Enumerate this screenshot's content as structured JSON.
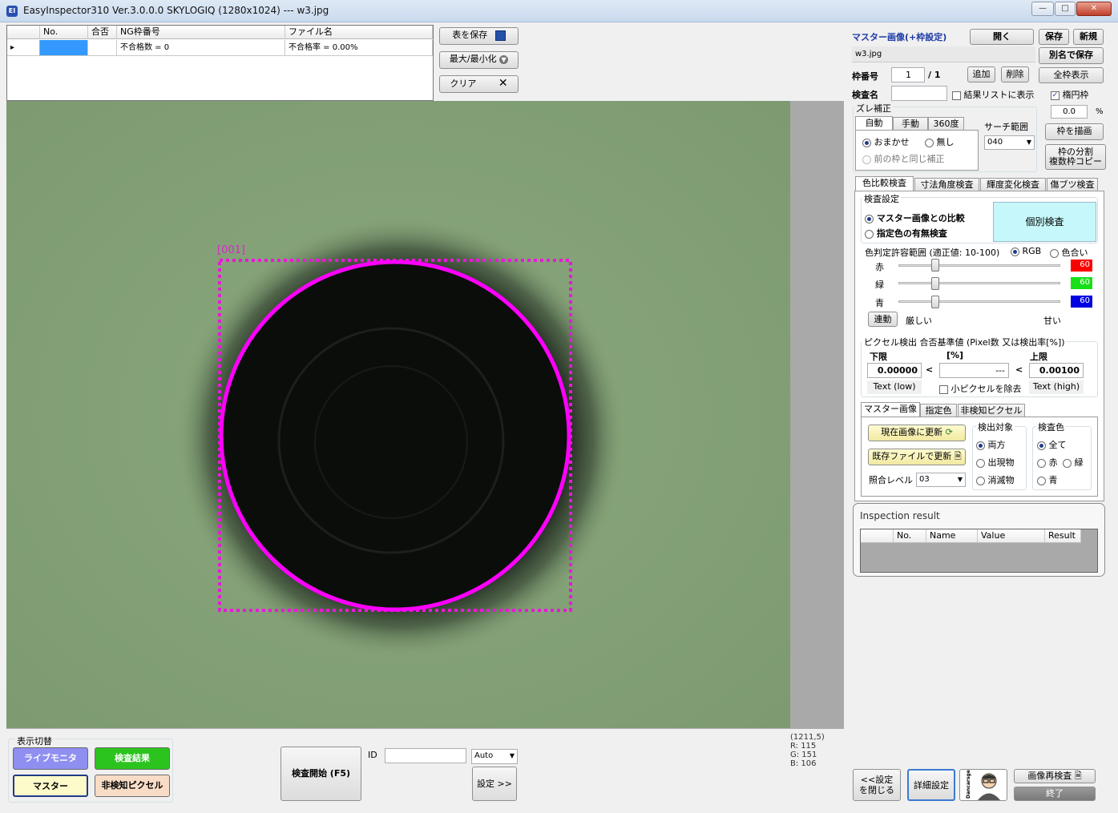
{
  "window": {
    "title": "EasyInspector310 Ver.3.0.0.0 SKYLOGIQ (1280x1024) --- w3.jpg",
    "min": "—",
    "max": "□",
    "close": "✕"
  },
  "grid": {
    "headers": [
      "No.",
      "合否",
      "NG枠番号",
      "ファイル名"
    ],
    "row": {
      "no": "",
      "pass": "",
      "ng": "不合格数 = 0",
      "file": "不合格率 = 0.00%"
    }
  },
  "buttons": {
    "save_table": "表を保存",
    "maxmin": "最大/最小化",
    "clear": "クリア"
  },
  "image": {
    "frame_label": "[001]"
  },
  "coords": {
    "pos": "(1211,5)",
    "r": "R: 115",
    "g": "G: 151",
    "b": "B: 106"
  },
  "display": {
    "title": "表示切替",
    "live": "ライブモニタ",
    "result": "検査結果",
    "master": "マスター",
    "nondetect": "非検知ピクセル",
    "colors": {
      "live": "#8f8ff2",
      "result": "#2bc41e",
      "master": "#fdfbc9",
      "nondetect": "#f8dcc6"
    }
  },
  "inspect_start": "検査開始 (F5)",
  "id_label": "ID",
  "id_value": "",
  "auto_combo": "Auto",
  "settings_btn": "設定 >>",
  "right": {
    "title": "マスター画像(+枠設定)",
    "open": "開く",
    "save": "保存",
    "new": "新規",
    "file": "w3.jpg",
    "save_as": "別名で保存",
    "frame_no_label": "枠番号",
    "frame_no": "1",
    "frame_total": "/ 1",
    "add": "追加",
    "delete": "削除",
    "show_all": "全枠表示",
    "name_label": "検査名",
    "name_value": "",
    "result_list": "結果リストに表示",
    "ellipse": "楕円枠",
    "percent_value": "0.0",
    "percent_unit": "%",
    "shift": "ズレ補正",
    "shift_tabs": [
      "自動",
      "手動",
      "360度"
    ],
    "auto_opt": "おまかせ",
    "none_opt": "無し",
    "same_opt": "前の枠と同じ補正",
    "search_label": "サーチ範囲",
    "search_value": "040",
    "draw_frame": "枠を描画",
    "split_copy_1": "枠の分割",
    "split_copy_2": "複数枠コピー",
    "insp_tabs": [
      "色比較検査",
      "寸法角度検査",
      "輝度変化検査",
      "傷ブツ検査"
    ],
    "insp_settings": "検査設定",
    "opt_master_compare": "マスター画像との比較",
    "opt_color_presence": "指定色の有無検査",
    "individual": "個別検査",
    "tolerance": "色判定許容範囲 (適正値: 10-100)",
    "rgb": "RGB",
    "hue": "色合い",
    "red": "赤",
    "green": "緑",
    "blue": "青",
    "red_val": "60",
    "green_val": "60",
    "blue_val": "60",
    "red_color": "#ff0000",
    "green_color": "#18e018",
    "blue_color": "#0000e0",
    "slider_level": 0.23,
    "link": "連動",
    "strict": "厳しい",
    "loose": "甘い",
    "pixel_title": "ピクセル検出 合否基準値 (Pixel数 又は検出率[%])",
    "lower": "下限",
    "unit": "[%]",
    "upper": "上限",
    "lower_val": "0.00000",
    "mid_val": "---",
    "upper_val": "0.00100",
    "lt": "<",
    "text_low": "Text (low)",
    "small_px": "小ピクセルを除去",
    "text_high": "Text (high)",
    "sub_tabs": [
      "マスター画像",
      "指定色",
      "非検知ピクセル"
    ],
    "update_current": "現在画像に更新",
    "update_file": "既存ファイルで更新",
    "match_level": "照合レベル",
    "match_value": "03",
    "detect_target": "検出対象",
    "both": "両方",
    "appear": "出現物",
    "vanish": "消滅物",
    "insp_color": "検査色",
    "all": "全て",
    "c_red": "赤",
    "c_green": "緑",
    "c_blue": "青"
  },
  "result": {
    "title": "Inspection result",
    "headers": [
      "No.",
      "Name",
      "Value",
      "Result"
    ]
  },
  "bottom_right": {
    "close_settings_1": "<<設定",
    "close_settings_2": "を閉じる",
    "detail": "詳細設定",
    "reinspect": "画像再検査",
    "exit": "終了",
    "brand": "Dancarsge"
  }
}
